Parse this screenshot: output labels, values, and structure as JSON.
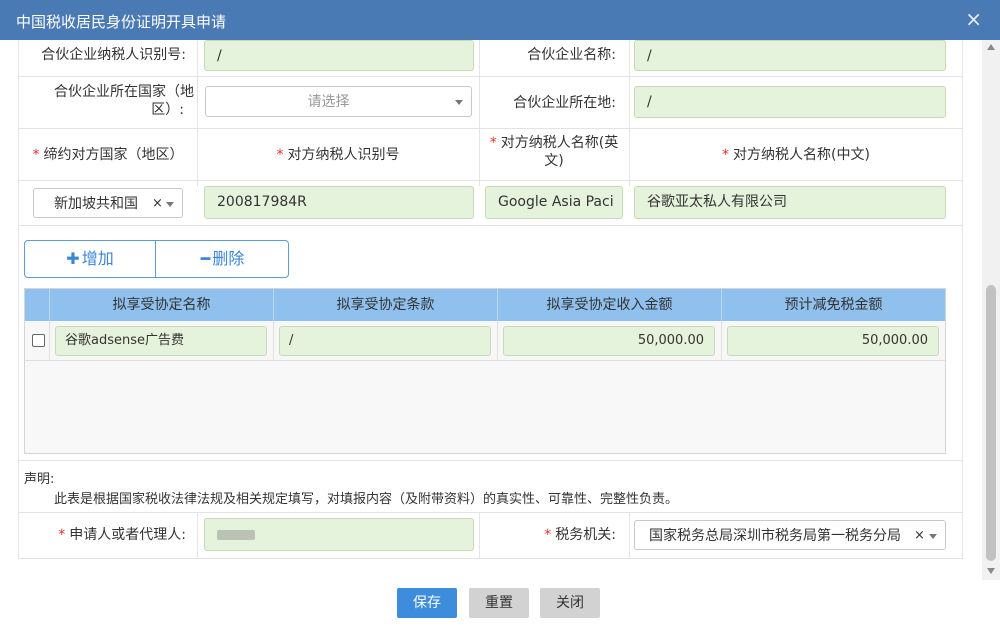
{
  "window": {
    "title": "中国税收居民身份证明开具申请",
    "close_icon": "×"
  },
  "form": {
    "partner_tax_id": {
      "label": "合伙企业纳税人识别号:",
      "value": "/"
    },
    "partner_name": {
      "label": "合伙企业名称:",
      "value": "/"
    },
    "partner_country": {
      "label_line1": "合伙企业所在国家（地",
      "label_line2": "区）:",
      "placeholder": "请选择"
    },
    "partner_location": {
      "label": "合伙企业所在地:",
      "value": "/"
    },
    "treaty_country": {
      "label": "缔约对方国家（地区）",
      "value": "新加坡共和国",
      "clear": "×"
    },
    "counterparty_tax_id": {
      "label": "对方纳税人识别号",
      "value": "200817984R"
    },
    "counterparty_name_en": {
      "label_line1": "对方纳税人名称(英",
      "label_line2": "文)",
      "value": "Google Asia Paci"
    },
    "counterparty_name_cn": {
      "label": "对方纳税人名称(中文)",
      "value": "谷歌亚太私人有限公司"
    },
    "required_mark": "*"
  },
  "actions": {
    "add_symbol": "✚",
    "add_label": "增加",
    "delete_symbol": "━",
    "delete_label": "删除"
  },
  "table": {
    "headers": [
      "拟享受协定名称",
      "拟享受协定条款",
      "拟享受协定收入金额",
      "预计减免税金额"
    ],
    "rows": [
      {
        "name": "谷歌adsense广告费",
        "clause": "/",
        "income": "50,000.00",
        "relief": "50,000.00"
      }
    ]
  },
  "declaration": {
    "title": "声明:",
    "text": "此表是根据国家税收法律法规及相关规定填写，对填报内容（及附带资料）的真实性、可靠性、完整性负责。"
  },
  "bottom": {
    "applicant": {
      "label": "申请人或者代理人:"
    },
    "tax_office": {
      "label": "税务机关:",
      "value": "国家税务总局深圳市税务局第一税务分局",
      "clear": "×"
    }
  },
  "footer": {
    "save": "保存",
    "reset": "重置",
    "close": "关闭"
  },
  "colors": {
    "title_bar": "#4a7ab3",
    "field_bg": "#e6f3dc",
    "table_header": "#8fc0ee",
    "primary_button": "#3d8ddc",
    "required": "#e0322b"
  }
}
